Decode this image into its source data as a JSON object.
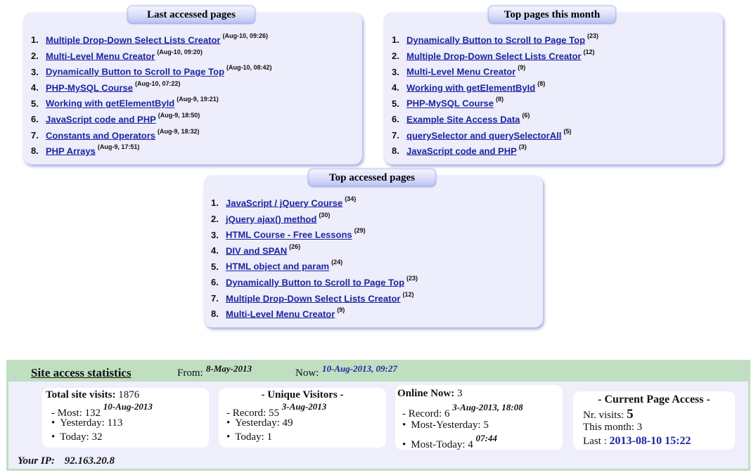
{
  "last_accessed": {
    "title": "Last accessed pages",
    "items": [
      {
        "num": "1.",
        "label": "Multiple Drop-Down Select Lists Creator",
        "meta": "(Aug-10, 09:26)"
      },
      {
        "num": "2.",
        "label": "Multi-Level Menu Creator",
        "meta": "(Aug-10, 09:20)"
      },
      {
        "num": "3.",
        "label": "Dynamically Button to Scroll to Page Top",
        "meta": "(Aug-10, 08:42)"
      },
      {
        "num": "4.",
        "label": "PHP-MySQL Course",
        "meta": "(Aug-10, 07:22)"
      },
      {
        "num": "5.",
        "label": "Working with getElementById",
        "meta": "(Aug-9, 19:21)"
      },
      {
        "num": "6.",
        "label": "JavaScript code and PHP",
        "meta": "(Aug-9, 18:50)"
      },
      {
        "num": "7.",
        "label": "Constants and Operators",
        "meta": "(Aug-9, 18:32)"
      },
      {
        "num": "8.",
        "label": "PHP Arrays",
        "meta": "(Aug-9, 17:51)"
      }
    ]
  },
  "top_month": {
    "title": "Top pages this month",
    "items": [
      {
        "num": "1.",
        "label": "Dynamically Button to Scroll to Page Top",
        "meta": "(23)"
      },
      {
        "num": "2.",
        "label": "Multiple Drop-Down Select Lists Creator",
        "meta": "(12)"
      },
      {
        "num": "3.",
        "label": "Multi-Level Menu Creator",
        "meta": "(9)"
      },
      {
        "num": "4.",
        "label": "Working with getElementById",
        "meta": "(8)"
      },
      {
        "num": "5.",
        "label": "PHP-MySQL Course",
        "meta": "(8)"
      },
      {
        "num": "6.",
        "label": "Example Site Access Data",
        "meta": "(6)"
      },
      {
        "num": "7.",
        "label": "querySelector and querySelectorAll",
        "meta": "(5)"
      },
      {
        "num": "8.",
        "label": "JavaScript code and PHP",
        "meta": "(3)"
      }
    ]
  },
  "top_accessed": {
    "title": "Top accessed pages",
    "items": [
      {
        "num": "1.",
        "label": "JavaScript / jQuery Course",
        "meta": "(34)"
      },
      {
        "num": "2.",
        "label": "jQuery ajax() method",
        "meta": "(30)"
      },
      {
        "num": "3.",
        "label": "HTML Course - Free Lessons",
        "meta": "(29)"
      },
      {
        "num": "4.",
        "label": "DIV and SPAN",
        "meta": "(26)"
      },
      {
        "num": "5.",
        "label": "HTML object and param",
        "meta": "(24)"
      },
      {
        "num": "6.",
        "label": "Dynamically Button to Scroll to Page Top",
        "meta": "(23)"
      },
      {
        "num": "7.",
        "label": "Multiple Drop-Down Select Lists Creator",
        "meta": "(12)"
      },
      {
        "num": "8.",
        "label": "Multi-Level Menu Creator",
        "meta": "(9)"
      }
    ]
  },
  "stats": {
    "title": "Site access statistics",
    "from_label": "From:",
    "from_value": "8-May-2013",
    "now_label": "Now:",
    "now_value": "10-Aug-2013, 09:27",
    "total": {
      "label": "Total site visits:",
      "value": "1876",
      "most_label": "- Most: 132",
      "most_date": "10-Aug-2013",
      "yesterday": "Yesterday: 113",
      "today": "Today: 32"
    },
    "unique": {
      "title": "- Unique Visitors -",
      "record_label": "- Record: 55",
      "record_date": "3-Aug-2013",
      "yesterday": "Yesterday: 49",
      "today": "Today: 1"
    },
    "online": {
      "label": "Online Now:",
      "value": "3",
      "record_label": "- Record: 6",
      "record_date": "3-Aug-2013, 18:08",
      "most_yesterday": "Most-Yesterday: 5",
      "most_today": "Most-Today: 4",
      "most_today_time": "07:44"
    },
    "current_page": {
      "title": "- Current Page Access -",
      "visits_label": "Nr. visits:",
      "visits_value": "5",
      "month": "This month: 3",
      "last_label": "Last :",
      "last_value": "2013-08-10 15:22"
    },
    "ip_label": "Your IP:",
    "ip_value": "92.163.20.8",
    "bullet": "•",
    "colors": {
      "header_green": "#bfdfc0",
      "link_blue": "#1f24a0",
      "panel_bg": "#ededfb"
    }
  }
}
